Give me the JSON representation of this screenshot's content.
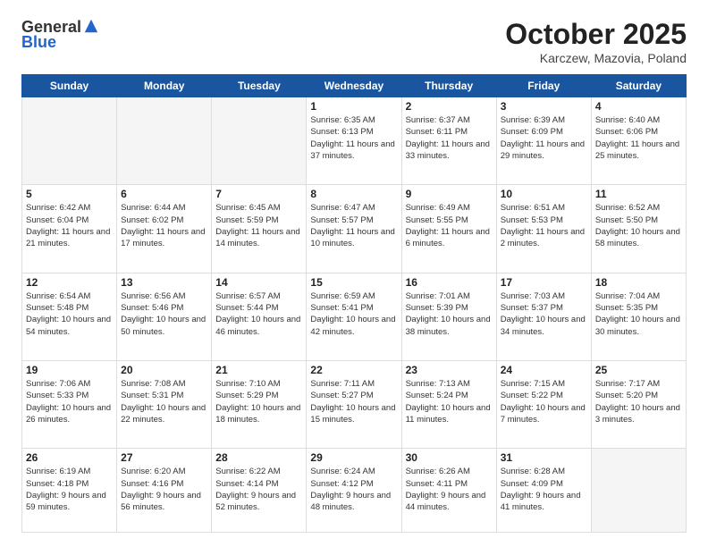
{
  "header": {
    "logo_general": "General",
    "logo_blue": "Blue",
    "month_title": "October 2025",
    "location": "Karczew, Mazovia, Poland"
  },
  "days_of_week": [
    "Sunday",
    "Monday",
    "Tuesday",
    "Wednesday",
    "Thursday",
    "Friday",
    "Saturday"
  ],
  "weeks": [
    [
      {
        "day": "",
        "info": ""
      },
      {
        "day": "",
        "info": ""
      },
      {
        "day": "",
        "info": ""
      },
      {
        "day": "1",
        "info": "Sunrise: 6:35 AM\nSunset: 6:13 PM\nDaylight: 11 hours\nand 37 minutes."
      },
      {
        "day": "2",
        "info": "Sunrise: 6:37 AM\nSunset: 6:11 PM\nDaylight: 11 hours\nand 33 minutes."
      },
      {
        "day": "3",
        "info": "Sunrise: 6:39 AM\nSunset: 6:09 PM\nDaylight: 11 hours\nand 29 minutes."
      },
      {
        "day": "4",
        "info": "Sunrise: 6:40 AM\nSunset: 6:06 PM\nDaylight: 11 hours\nand 25 minutes."
      }
    ],
    [
      {
        "day": "5",
        "info": "Sunrise: 6:42 AM\nSunset: 6:04 PM\nDaylight: 11 hours\nand 21 minutes."
      },
      {
        "day": "6",
        "info": "Sunrise: 6:44 AM\nSunset: 6:02 PM\nDaylight: 11 hours\nand 17 minutes."
      },
      {
        "day": "7",
        "info": "Sunrise: 6:45 AM\nSunset: 5:59 PM\nDaylight: 11 hours\nand 14 minutes."
      },
      {
        "day": "8",
        "info": "Sunrise: 6:47 AM\nSunset: 5:57 PM\nDaylight: 11 hours\nand 10 minutes."
      },
      {
        "day": "9",
        "info": "Sunrise: 6:49 AM\nSunset: 5:55 PM\nDaylight: 11 hours\nand 6 minutes."
      },
      {
        "day": "10",
        "info": "Sunrise: 6:51 AM\nSunset: 5:53 PM\nDaylight: 11 hours\nand 2 minutes."
      },
      {
        "day": "11",
        "info": "Sunrise: 6:52 AM\nSunset: 5:50 PM\nDaylight: 10 hours\nand 58 minutes."
      }
    ],
    [
      {
        "day": "12",
        "info": "Sunrise: 6:54 AM\nSunset: 5:48 PM\nDaylight: 10 hours\nand 54 minutes."
      },
      {
        "day": "13",
        "info": "Sunrise: 6:56 AM\nSunset: 5:46 PM\nDaylight: 10 hours\nand 50 minutes."
      },
      {
        "day": "14",
        "info": "Sunrise: 6:57 AM\nSunset: 5:44 PM\nDaylight: 10 hours\nand 46 minutes."
      },
      {
        "day": "15",
        "info": "Sunrise: 6:59 AM\nSunset: 5:41 PM\nDaylight: 10 hours\nand 42 minutes."
      },
      {
        "day": "16",
        "info": "Sunrise: 7:01 AM\nSunset: 5:39 PM\nDaylight: 10 hours\nand 38 minutes."
      },
      {
        "day": "17",
        "info": "Sunrise: 7:03 AM\nSunset: 5:37 PM\nDaylight: 10 hours\nand 34 minutes."
      },
      {
        "day": "18",
        "info": "Sunrise: 7:04 AM\nSunset: 5:35 PM\nDaylight: 10 hours\nand 30 minutes."
      }
    ],
    [
      {
        "day": "19",
        "info": "Sunrise: 7:06 AM\nSunset: 5:33 PM\nDaylight: 10 hours\nand 26 minutes."
      },
      {
        "day": "20",
        "info": "Sunrise: 7:08 AM\nSunset: 5:31 PM\nDaylight: 10 hours\nand 22 minutes."
      },
      {
        "day": "21",
        "info": "Sunrise: 7:10 AM\nSunset: 5:29 PM\nDaylight: 10 hours\nand 18 minutes."
      },
      {
        "day": "22",
        "info": "Sunrise: 7:11 AM\nSunset: 5:27 PM\nDaylight: 10 hours\nand 15 minutes."
      },
      {
        "day": "23",
        "info": "Sunrise: 7:13 AM\nSunset: 5:24 PM\nDaylight: 10 hours\nand 11 minutes."
      },
      {
        "day": "24",
        "info": "Sunrise: 7:15 AM\nSunset: 5:22 PM\nDaylight: 10 hours\nand 7 minutes."
      },
      {
        "day": "25",
        "info": "Sunrise: 7:17 AM\nSunset: 5:20 PM\nDaylight: 10 hours\nand 3 minutes."
      }
    ],
    [
      {
        "day": "26",
        "info": "Sunrise: 6:19 AM\nSunset: 4:18 PM\nDaylight: 9 hours\nand 59 minutes."
      },
      {
        "day": "27",
        "info": "Sunrise: 6:20 AM\nSunset: 4:16 PM\nDaylight: 9 hours\nand 56 minutes."
      },
      {
        "day": "28",
        "info": "Sunrise: 6:22 AM\nSunset: 4:14 PM\nDaylight: 9 hours\nand 52 minutes."
      },
      {
        "day": "29",
        "info": "Sunrise: 6:24 AM\nSunset: 4:12 PM\nDaylight: 9 hours\nand 48 minutes."
      },
      {
        "day": "30",
        "info": "Sunrise: 6:26 AM\nSunset: 4:11 PM\nDaylight: 9 hours\nand 44 minutes."
      },
      {
        "day": "31",
        "info": "Sunrise: 6:28 AM\nSunset: 4:09 PM\nDaylight: 9 hours\nand 41 minutes."
      },
      {
        "day": "",
        "info": ""
      }
    ]
  ]
}
